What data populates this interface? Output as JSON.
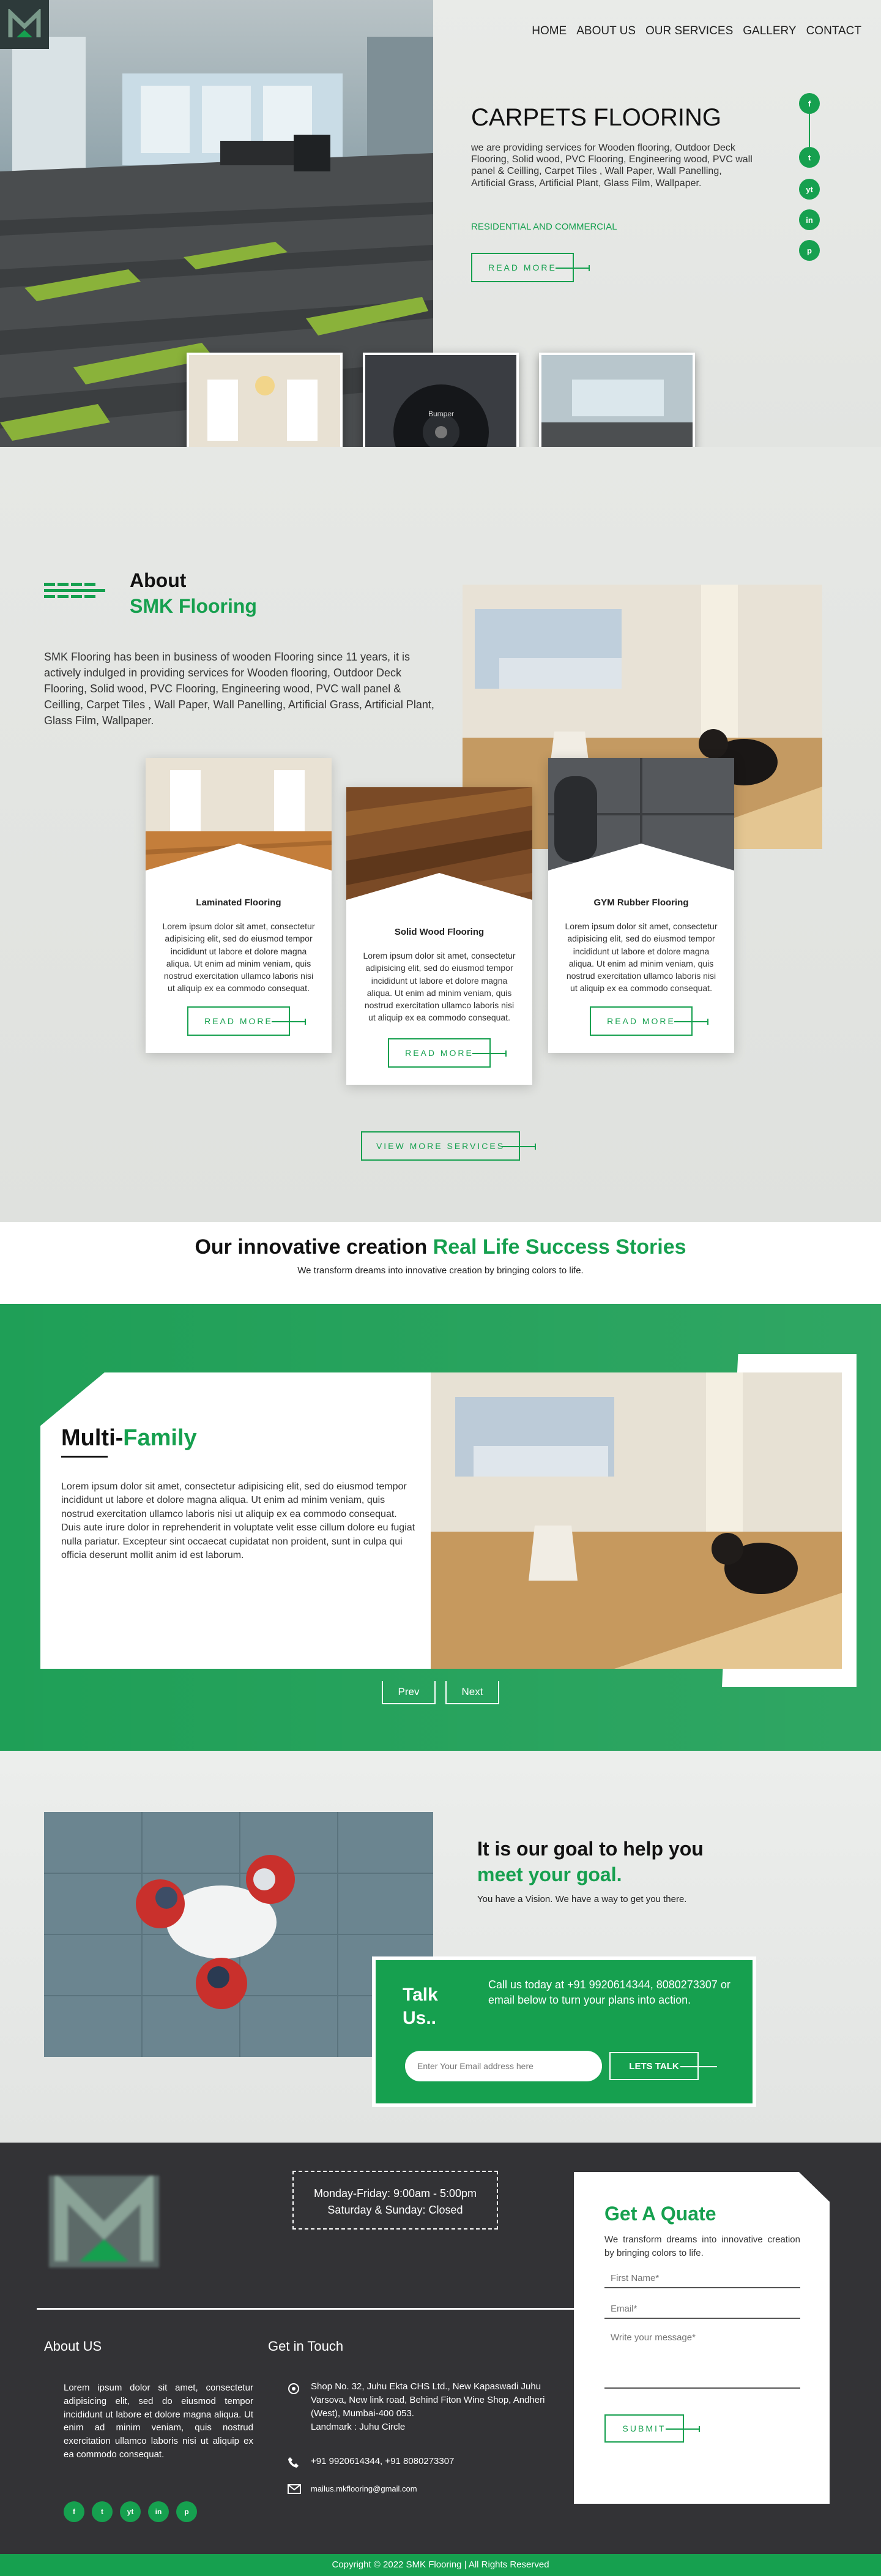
{
  "nav": {
    "items": [
      "HOME",
      "ABOUT US",
      "OUR SERVICES",
      "GALLERY",
      "CONTACT"
    ]
  },
  "hero": {
    "title": "CARPETS FLOORING",
    "description": "we are providing services for Wooden flooring, Outdoor Deck Flooring, Solid wood, PVC Flooring, Engineering wood, PVC wall panel & Ceilling, Carpet Tiles , Wall Paper, Wall Panelling, Artificial Grass, Artificial Plant, Glass Film, Wallpaper.",
    "tag": "RESIDENTIAL AND COMMERCIAL",
    "button": "READ MORE"
  },
  "social": [
    "f",
    "t",
    "yt",
    "in",
    "p"
  ],
  "about": {
    "heading": "About",
    "brand": "SMK Flooring",
    "text": "SMK Flooring has been in business of wooden Flooring since 11 years, it is actively indulged in providing services for Wooden flooring, Outdoor Deck Flooring, Solid wood, PVC Flooring, Engineering wood, PVC wall panel & Ceilling, Carpet Tiles , Wall Paper, Wall Panelling, Artificial Grass, Artificial Plant, Glass Film, Wallpaper."
  },
  "services": [
    {
      "title": "Laminated Flooring",
      "text": "Lorem ipsum dolor sit amet, consectetur adipisicing elit, sed do eiusmod tempor incididunt ut labore et dolore magna aliqua. Ut enim ad minim veniam, quis nostrud exercitation ullamco laboris nisi ut aliquip ex ea commodo consequat.",
      "button": "READ MORE"
    },
    {
      "title": "Solid Wood Flooring",
      "text": "Lorem ipsum dolor sit amet, consectetur adipisicing elit, sed do eiusmod tempor incididunt ut labore et dolore magna aliqua. Ut enim ad minim veniam, quis nostrud exercitation ullamco laboris nisi ut aliquip ex ea commodo consequat.",
      "button": "READ MORE"
    },
    {
      "title": "GYM Rubber Flooring",
      "text": "Lorem ipsum dolor sit amet, consectetur adipisicing elit, sed do eiusmod tempor incididunt ut labore et dolore magna aliqua. Ut enim ad minim veniam, quis nostrud exercitation ullamco laboris nisi ut aliquip ex ea commodo consequat.",
      "button": "READ MORE"
    }
  ],
  "view_more": "VIEW MORE SERVICES",
  "stories": {
    "heading": "Our innovative creation",
    "heading_green": "Real Life Success Stories",
    "sub": "We transform dreams into innovative creation by bringing colors to life."
  },
  "slide": {
    "title": "Multi-",
    "title_green": "Family",
    "text": "Lorem ipsum dolor sit amet, consectetur adipisicing elit, sed do eiusmod tempor incididunt ut labore et dolore magna aliqua. Ut enim ad minim veniam, quis nostrud exercitation ullamco laboris nisi ut aliquip ex ea commodo consequat. Duis aute irure dolor in reprehenderit in voluptate velit esse cillum dolore eu fugiat nulla pariatur. Excepteur sint occaecat cupidatat non proident, sunt in culpa qui officia deserunt mollit anim id est laborum.",
    "prev": "Prev",
    "next": "Next"
  },
  "goal": {
    "heading": "It is our goal to help you",
    "heading_green": "meet your goal.",
    "sub": "You have a Vision. We have a way to get you there."
  },
  "talk": {
    "title": "Talk Us..",
    "text": "Call us today at +91 9920614344, 8080273307 or email below to turn your plans into action.",
    "placeholder": "Enter Your Email address here",
    "button": "LETS TALK"
  },
  "footer": {
    "hours1": "Monday-Friday: 9:00am - 5:00pm",
    "hours2": "Saturday & Sunday: Closed",
    "about_title": "About US",
    "about_text": "Lorem ipsum dolor sit amet, consectetur adipisicing elit, sed do eiusmod tempor incididunt ut labore et dolore magna aliqua. Ut enim ad minim veniam, quis nostrud exercitation ullamco laboris nisi ut aliquip ex ea commodo consequat.",
    "touch_title": "Get in Touch",
    "address": "Shop No. 32, Juhu Ekta CHS Ltd., New Kapaswadi Juhu Varsova, New link road, Behind Fiton Wine Shop, Andheri (West), Mumbai-400 053.",
    "landmark": "Landmark : Juhu Circle",
    "phone": "+91 9920614344, +91 8080273307",
    "email": "mailus.mkflooring@gmail.com",
    "copyright": "Copyright © 2022 SMK Flooring | All Rights Reserved"
  },
  "quote": {
    "title": "Get A Quate",
    "sub": "We transform dreams into innovative creation by bringing colors to life.",
    "name": "First Name*",
    "email": "Email*",
    "message": "Write your message*",
    "button": "SUBMIT"
  },
  "colors": {
    "accent": "#16a04f",
    "footer": "#333336"
  }
}
